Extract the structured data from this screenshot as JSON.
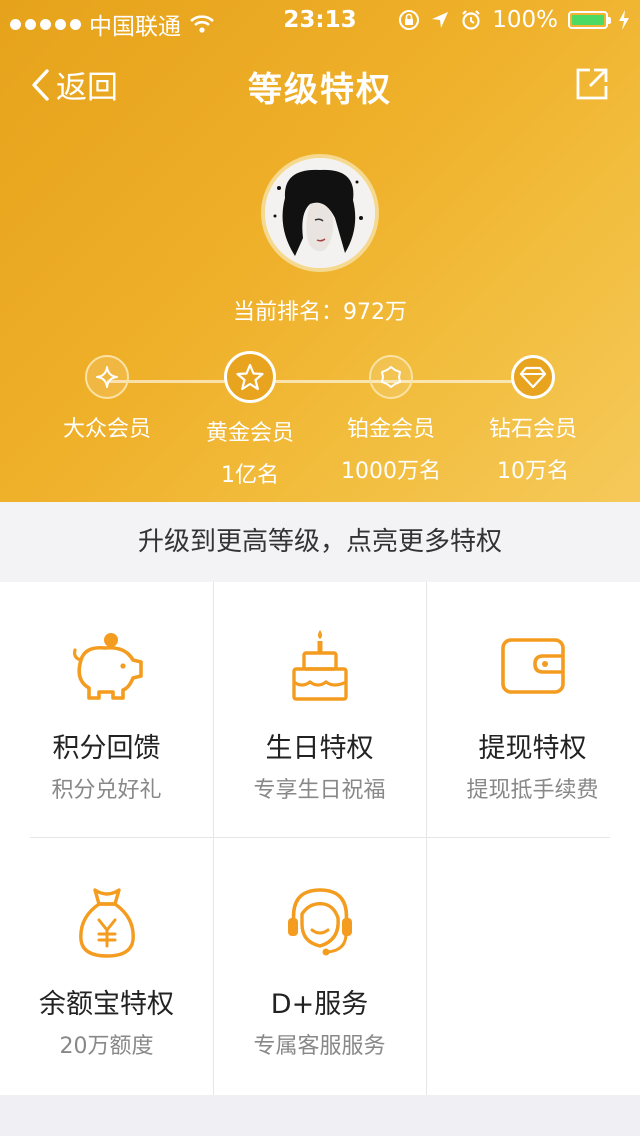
{
  "status_bar": {
    "carrier": "中国联通",
    "time": "23:13",
    "battery": "100%"
  },
  "nav": {
    "back_label": "返回",
    "title": "等级特权"
  },
  "profile": {
    "rank_label": "当前排名：972万"
  },
  "levels": [
    {
      "name": "大众会员",
      "count": ""
    },
    {
      "name": "黄金会员",
      "count": "1亿名"
    },
    {
      "name": "铂金会员",
      "count": "1000万名"
    },
    {
      "name": "钻石会员",
      "count": "10万名"
    }
  ],
  "current_level_index": 1,
  "banner": "升级到更高等级，点亮更多特权",
  "privileges": [
    {
      "title": "积分回馈",
      "subtitle": "积分兑好礼",
      "icon": "piggy-bank-icon"
    },
    {
      "title": "生日特权",
      "subtitle": "专享生日祝福",
      "icon": "birthday-cake-icon"
    },
    {
      "title": "提现特权",
      "subtitle": "提现抵手续费",
      "icon": "wallet-icon"
    },
    {
      "title": "余额宝特权",
      "subtitle": "20万额度",
      "icon": "money-bag-icon"
    },
    {
      "title": "D+服务",
      "subtitle": "专属客服服务",
      "icon": "customer-service-icon"
    }
  ],
  "colors": {
    "accent": "#f39c1f",
    "header_gold": "#eeae28",
    "battery_green": "#4cd964"
  }
}
